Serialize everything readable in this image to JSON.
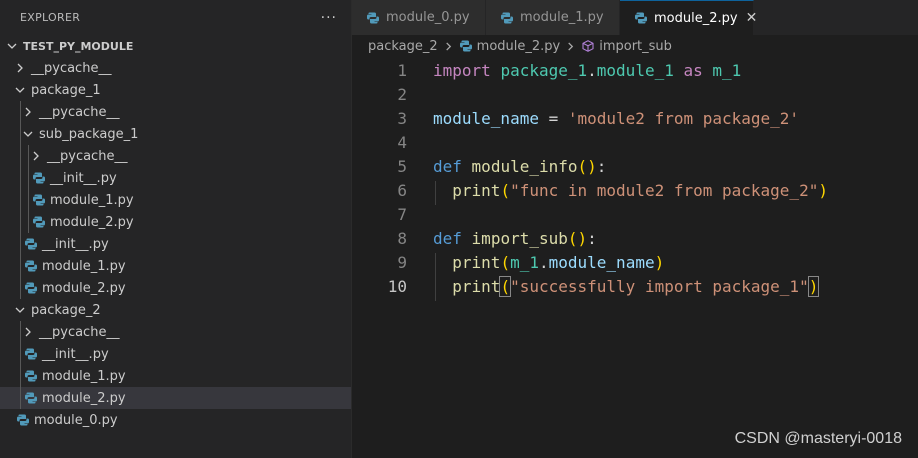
{
  "explorer": {
    "title": "EXPLORER",
    "more": "···",
    "tree": [
      {
        "label": "TEST_PY_MODULE",
        "type": "root",
        "depth": 0,
        "open": true
      },
      {
        "label": "__pycache__",
        "type": "folder",
        "depth": 1,
        "open": false
      },
      {
        "label": "package_1",
        "type": "folder",
        "depth": 1,
        "open": true
      },
      {
        "label": "__pycache__",
        "type": "folder",
        "depth": 2,
        "open": false
      },
      {
        "label": "sub_package_1",
        "type": "folder",
        "depth": 2,
        "open": true
      },
      {
        "label": "__pycache__",
        "type": "folder",
        "depth": 3,
        "open": false
      },
      {
        "label": "__init__.py",
        "type": "file",
        "depth": 3
      },
      {
        "label": "module_1.py",
        "type": "file",
        "depth": 3
      },
      {
        "label": "module_2.py",
        "type": "file",
        "depth": 3
      },
      {
        "label": "__init__.py",
        "type": "file",
        "depth": 2
      },
      {
        "label": "module_1.py",
        "type": "file",
        "depth": 2
      },
      {
        "label": "module_2.py",
        "type": "file",
        "depth": 2
      },
      {
        "label": "package_2",
        "type": "folder",
        "depth": 1,
        "open": true
      },
      {
        "label": "__pycache__",
        "type": "folder",
        "depth": 2,
        "open": false
      },
      {
        "label": "__init__.py",
        "type": "file",
        "depth": 2
      },
      {
        "label": "module_1.py",
        "type": "file",
        "depth": 2
      },
      {
        "label": "module_2.py",
        "type": "file",
        "depth": 2,
        "selected": true
      },
      {
        "label": "module_0.py",
        "type": "file",
        "depth": 1
      }
    ]
  },
  "tabs": [
    {
      "label": "module_0.py",
      "active": false
    },
    {
      "label": "module_1.py",
      "active": false
    },
    {
      "label": "module_2.py",
      "active": true,
      "close": "✕"
    }
  ],
  "breadcrumb": {
    "folder": "package_2",
    "file": "module_2.py",
    "symbol": "import_sub"
  },
  "editor": {
    "current_line": 10,
    "lines": [
      {
        "n": "1",
        "tokens": [
          [
            "kw",
            "import"
          ],
          [
            "op",
            " "
          ],
          [
            "mod",
            "package_1"
          ],
          [
            "op",
            "."
          ],
          [
            "mod",
            "module_1"
          ],
          [
            "op",
            " "
          ],
          [
            "kw",
            "as"
          ],
          [
            "op",
            " "
          ],
          [
            "mod",
            "m_1"
          ]
        ]
      },
      {
        "n": "2",
        "tokens": []
      },
      {
        "n": "3",
        "tokens": [
          [
            "var",
            "module_name"
          ],
          [
            "op",
            " = "
          ],
          [
            "str",
            "'module2 from package_2'"
          ]
        ]
      },
      {
        "n": "4",
        "tokens": []
      },
      {
        "n": "5",
        "tokens": [
          [
            "kw2",
            "def"
          ],
          [
            "op",
            " "
          ],
          [
            "fn",
            "module_info"
          ],
          [
            "p1",
            "()"
          ],
          [
            "op",
            ":"
          ]
        ]
      },
      {
        "n": "6",
        "indent": true,
        "tokens": [
          [
            "op",
            "  "
          ],
          [
            "fn",
            "print"
          ],
          [
            "p1",
            "("
          ],
          [
            "str",
            "\"func in module2 from package_2\""
          ],
          [
            "p1",
            ")"
          ]
        ]
      },
      {
        "n": "7",
        "tokens": []
      },
      {
        "n": "8",
        "tokens": [
          [
            "kw2",
            "def"
          ],
          [
            "op",
            " "
          ],
          [
            "fn",
            "import_sub"
          ],
          [
            "p1",
            "()"
          ],
          [
            "op",
            ":"
          ]
        ]
      },
      {
        "n": "9",
        "indent": true,
        "tokens": [
          [
            "op",
            "  "
          ],
          [
            "fn",
            "print"
          ],
          [
            "p1",
            "("
          ],
          [
            "mod",
            "m_1"
          ],
          [
            "op",
            "."
          ],
          [
            "var",
            "module_name"
          ],
          [
            "p1",
            ")"
          ]
        ]
      },
      {
        "n": "10",
        "indent": true,
        "tokens": [
          [
            "op",
            "  "
          ],
          [
            "fn",
            "print"
          ],
          [
            "p1 bm",
            "("
          ],
          [
            "str",
            "\"successfully import package_1\""
          ],
          [
            "p1 bm",
            ")"
          ]
        ]
      }
    ]
  },
  "watermark": "CSDN @masteryi-0018",
  "colors": {
    "python_icon": "#519aba",
    "selection": "#37373d",
    "tab_active_border": "#0e639c"
  }
}
